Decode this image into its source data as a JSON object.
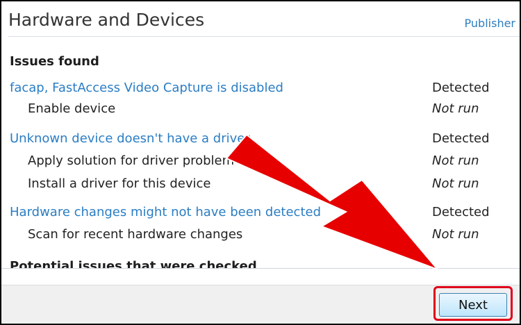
{
  "window": {
    "title": "Hardware and Devices",
    "publisher_link": "Publisher"
  },
  "issues_found": {
    "heading": "Issues found",
    "groups": [
      {
        "issue": "facap, FastAccess Video Capture is disabled",
        "status": "Detected",
        "steps": [
          {
            "label": "Enable device",
            "status": "Not run"
          }
        ]
      },
      {
        "issue": "Unknown device doesn't have a driver",
        "status": "Detected",
        "steps": [
          {
            "label": "Apply solution for driver problem",
            "status": "Not run"
          },
          {
            "label": "Install a driver for this device",
            "status": "Not run"
          }
        ]
      },
      {
        "issue": "Hardware changes might not have been detected",
        "status": "Detected",
        "steps": [
          {
            "label": "Scan for recent hardware changes",
            "status": "Not run"
          }
        ]
      }
    ]
  },
  "potential_issues": {
    "heading": "Potential issues that were checked"
  },
  "footer": {
    "next_label": "Next"
  },
  "colors": {
    "link": "#2a7dc4",
    "annotation_red": "#e60000",
    "highlight_border": "#e0001a"
  }
}
